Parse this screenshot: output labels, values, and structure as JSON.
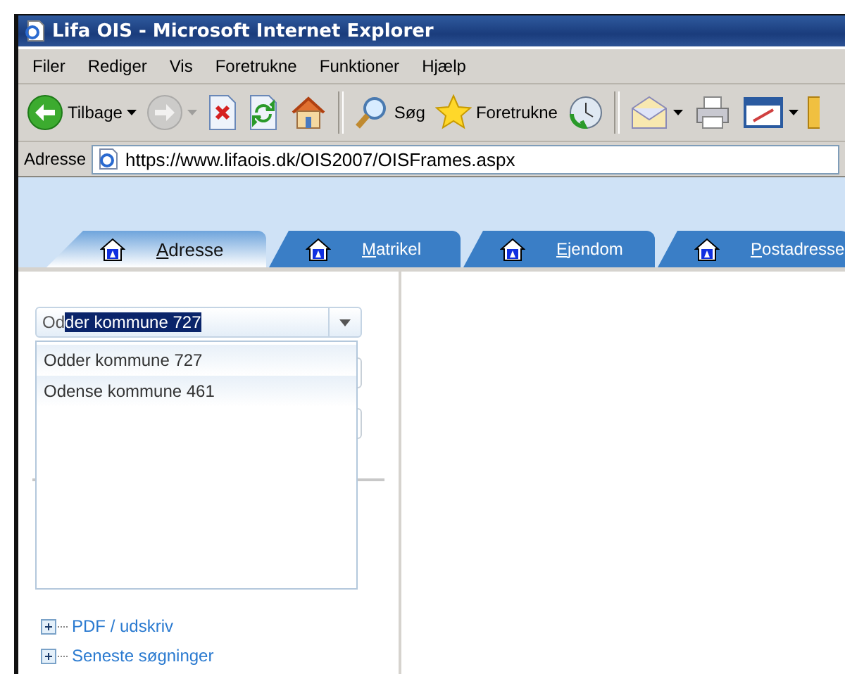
{
  "window": {
    "title": "Lifa OIS - Microsoft Internet Explorer"
  },
  "menu": [
    "Filer",
    "Rediger",
    "Vis",
    "Foretrukne",
    "Funktioner",
    "Hjælp"
  ],
  "toolbar": [
    {
      "kind": "back",
      "label": "Tilbage",
      "dropdown": true,
      "disabled": false
    },
    {
      "kind": "forward",
      "dropdown": true,
      "disabled": true
    },
    {
      "kind": "stop",
      "dropdown": false,
      "disabled": false
    },
    {
      "kind": "refresh",
      "dropdown": false,
      "disabled": false
    },
    {
      "kind": "home",
      "dropdown": false,
      "disabled": false
    },
    {
      "kind": "separator"
    },
    {
      "kind": "search",
      "label": "Søg",
      "dropdown": false,
      "disabled": false
    },
    {
      "kind": "favorites",
      "label": "Foretrukne",
      "dropdown": false,
      "disabled": false
    },
    {
      "kind": "history",
      "dropdown": false,
      "disabled": false
    },
    {
      "kind": "separator"
    },
    {
      "kind": "mail",
      "dropdown": true,
      "disabled": false
    },
    {
      "kind": "print",
      "dropdown": false,
      "disabled": false
    },
    {
      "kind": "edit",
      "dropdown": true,
      "disabled": false
    }
  ],
  "address": {
    "label": "Adresse",
    "url": "https://www.lifaois.dk/OIS2007/OISFrames.aspx"
  },
  "tabs": [
    {
      "label": "Adresse",
      "selected": true
    },
    {
      "label": "Matrikel",
      "selected": false
    },
    {
      "label": "Ejendom",
      "selected": false
    },
    {
      "label": "Postadresse",
      "selected": false
    }
  ],
  "municipality": {
    "typed": "Od",
    "completion": "der kommune 727",
    "options": [
      "Odder kommune 727",
      "Odense kommune 461"
    ]
  },
  "tree": [
    {
      "label": "PDF / udskriv",
      "expanded": false
    },
    {
      "label": "Seneste søgninger",
      "expanded": false
    }
  ]
}
